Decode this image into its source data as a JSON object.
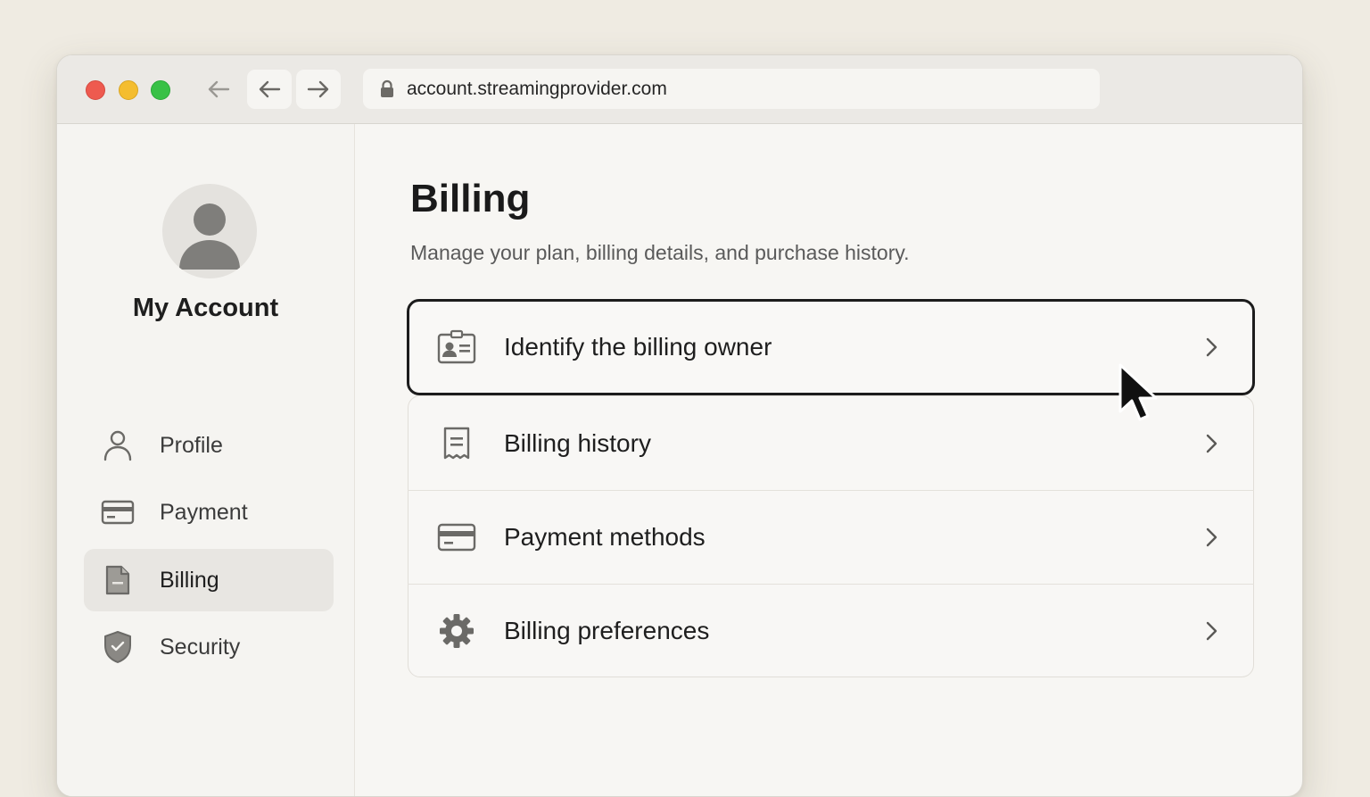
{
  "browser": {
    "url": "account.streamingprovider.com"
  },
  "sidebar": {
    "title": "My Account",
    "items": [
      {
        "label": "Profile",
        "icon": "person-icon"
      },
      {
        "label": "Payment",
        "icon": "credit-card-icon"
      },
      {
        "label": "Billing",
        "icon": "document-icon",
        "active": true
      },
      {
        "label": "Security",
        "icon": "shield-icon"
      }
    ]
  },
  "main": {
    "title": "Billing",
    "subtitle": "Manage your plan, billing details, and purchase history.",
    "options": [
      {
        "label": "Identify the billing owner",
        "icon": "id-card-icon",
        "highlighted": true
      },
      {
        "label": "Billing history",
        "icon": "receipt-icon"
      },
      {
        "label": "Payment methods",
        "icon": "credit-card-icon"
      },
      {
        "label": "Billing preferences",
        "icon": "gear-icon"
      }
    ]
  },
  "colors": {
    "background": "#efebe2",
    "window": "#f7f6f3",
    "active_item": "#e8e6e2",
    "highlight_border": "#1c1c1c",
    "traffic_red": "#ee5a4f",
    "traffic_yellow": "#f4bd2f",
    "traffic_green": "#38c146"
  }
}
